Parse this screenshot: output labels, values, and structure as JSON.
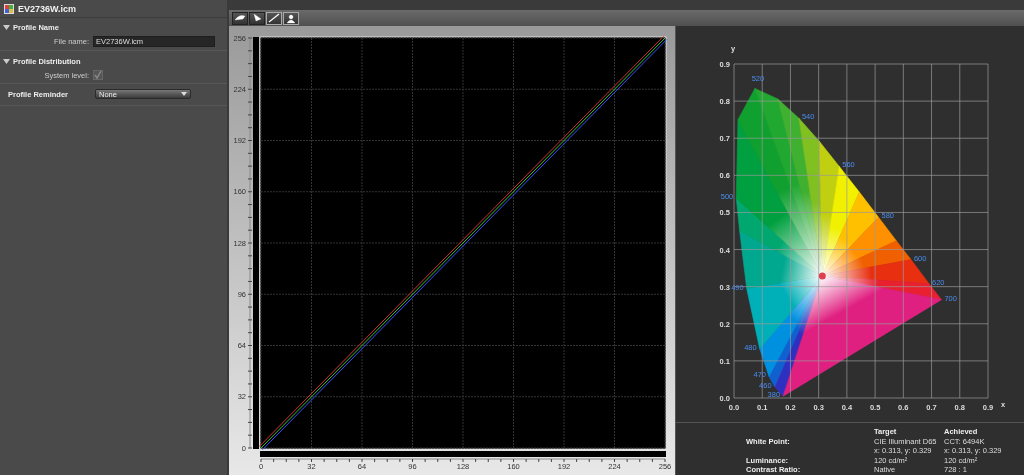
{
  "left_panel": {
    "title": "EV2736W.icm",
    "sections": [
      {
        "kind": "section",
        "title": "Profile Name",
        "expanded": true,
        "fields": [
          {
            "kind": "text",
            "label": "File name:",
            "value": "EV2736W.icm"
          }
        ]
      },
      {
        "kind": "section",
        "title": "Profile Distribution",
        "expanded": true,
        "fields": [
          {
            "kind": "checkbox",
            "label": "System level:",
            "checked": true,
            "disabled": true
          }
        ]
      },
      {
        "kind": "dropdown",
        "title": "Profile Reminder",
        "value": "None"
      }
    ]
  },
  "tone_curve": {
    "chart_data": {
      "type": "line",
      "grid": true,
      "x": [
        0,
        256
      ],
      "xlim": [
        0,
        256
      ],
      "ylim": [
        0,
        256
      ],
      "xticks": [
        0,
        32,
        64,
        96,
        128,
        160,
        192,
        224,
        256
      ],
      "yticks": [
        0,
        32,
        64,
        96,
        128,
        160,
        192,
        224,
        256
      ],
      "series": [
        {
          "color": "#d03030",
          "values": [
            0,
            256
          ]
        },
        {
          "color": "#30c030",
          "values": [
            0,
            256
          ]
        },
        {
          "color": "#3050ff",
          "values": [
            0,
            256
          ]
        }
      ]
    }
  },
  "chromaticity": {
    "chart_data": {
      "type": "scatter",
      "grid": true,
      "xlabel": "x",
      "ylabel": "y",
      "xlim": [
        0,
        0.9
      ],
      "ylim": [
        0,
        0.9
      ],
      "x": [
        0.313
      ],
      "xticks": [
        {
          "value": 0,
          "label": "0.0"
        },
        0.1,
        0.2,
        0.3,
        0.4,
        0.5,
        0.6,
        0.7,
        0.8,
        0.9
      ],
      "yticks": [
        {
          "value": 0,
          "label": "0.0"
        },
        0.1,
        0.2,
        0.3,
        0.4,
        0.5,
        0.6,
        0.7,
        0.8,
        0.9
      ],
      "series": [
        {
          "color": "#e04050",
          "values": [
            0.329
          ]
        }
      ],
      "annotations": [
        "520",
        "540",
        "560",
        "500",
        "580",
        "600",
        "620",
        "700",
        "490",
        "480",
        "470",
        "460",
        "380"
      ]
    }
  },
  "summary": {
    "columns": [
      "Target",
      "Achieved"
    ],
    "rows": [
      {
        "label": "White Point:",
        "target": "CIE Illuminant D65",
        "achieved": "CCT: 6494K"
      },
      {
        "target": "x: 0.313, y: 0.329",
        "achieved": "x: 0.313, y: 0.329"
      },
      {
        "label": "Luminance:",
        "target": "120 cd/m²",
        "achieved": "120 cd/m²"
      },
      {
        "label": "Contrast Ratio:",
        "target": "Native",
        "achieved": "728 : 1"
      }
    ]
  }
}
